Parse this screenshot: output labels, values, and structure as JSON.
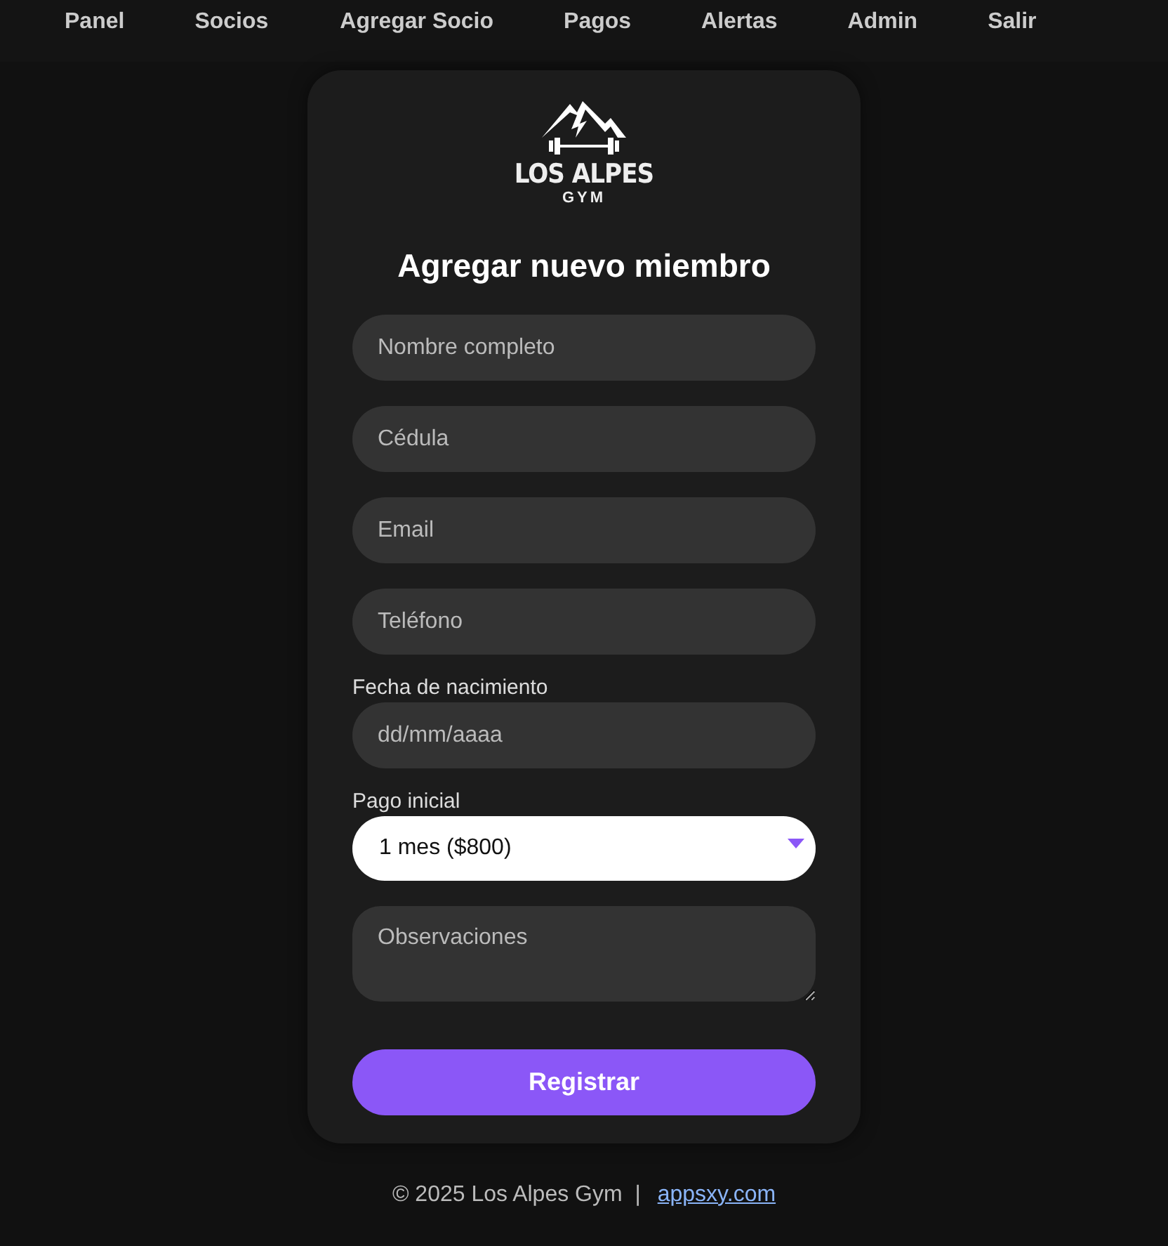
{
  "nav": [
    {
      "label": "Panel"
    },
    {
      "label": "Socios"
    },
    {
      "label": "Agregar Socio"
    },
    {
      "label": "Pagos"
    },
    {
      "label": "Alertas"
    },
    {
      "label": "Admin"
    },
    {
      "label": "Salir"
    }
  ],
  "logo": {
    "name": "LOS ALPES",
    "sub": "GYM"
  },
  "form": {
    "title": "Agregar nuevo miembro",
    "fields": [
      {
        "kind": "input",
        "placeholder": "Nombre completo"
      },
      {
        "kind": "input",
        "placeholder": "Cédula"
      },
      {
        "kind": "input",
        "placeholder": "Email"
      },
      {
        "kind": "input",
        "placeholder": "Teléfono"
      },
      {
        "kind": "date",
        "label": "Fecha de nacimiento",
        "placeholder": "dd/mm/aaaa"
      },
      {
        "kind": "select",
        "label": "Pago inicial",
        "value": "1 mes ($800)"
      },
      {
        "kind": "textarea",
        "placeholder": "Observaciones"
      }
    ],
    "submit": "Registrar"
  },
  "footer": {
    "text": "© 2025 Los Alpes Gym  |",
    "link": "appsxy.com"
  }
}
